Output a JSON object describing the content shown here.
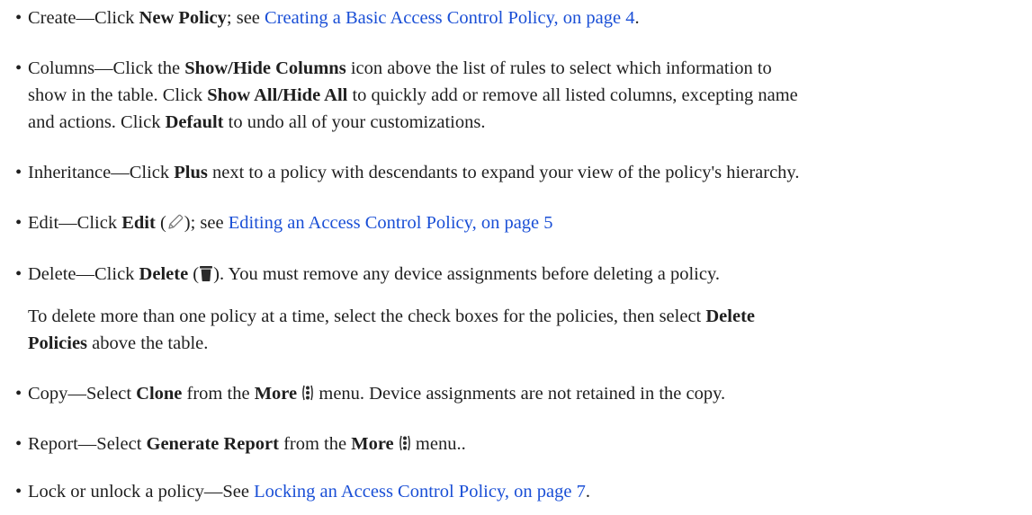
{
  "items": {
    "create": {
      "bullet": "•",
      "term": "Create",
      "dash": "—",
      "t1": "Click ",
      "b1": "New Policy",
      "t2": "; see ",
      "link": "Creating a Basic Access Control Policy, on page 4",
      "t3": "."
    },
    "columns": {
      "bullet": "•",
      "term": "Columns",
      "dash": "—",
      "t1": "Click the ",
      "b1": "Show/Hide Columns",
      "t2": " icon above the list of rules to select which information to",
      "t3": "show in the table. Click ",
      "b2": "Show All/Hide All",
      "t4": " to quickly add or remove all listed columns, excepting name",
      "t5": "and actions. Click ",
      "b3": "Default",
      "t6": " to undo all of your customizations."
    },
    "inheritance": {
      "bullet": "•",
      "term": "Inheritance",
      "dash": "—",
      "t1": "Click ",
      "b1": "Plus",
      "t2": " next to a policy with descendants to expand your view of the policy's hierarchy."
    },
    "edit": {
      "bullet": "•",
      "term": "Edit",
      "dash": "—",
      "t1": "Click ",
      "b1": "Edit",
      "t2": " (",
      "icon": "pencil-icon",
      "t3": "); see ",
      "link": "Editing an Access Control Policy, on page 5"
    },
    "delete": {
      "bullet": "•",
      "term": "Delete",
      "dash": "—",
      "t1": "Click ",
      "b1": "Delete",
      "t2": " (",
      "icon": "trash-icon",
      "t3": "). You must remove any device assignments before deleting a policy.",
      "note1": "To delete more than one policy at a time, select the check boxes for the policies, then select ",
      "note_b1": "Delete",
      "note_b2": "Policies",
      "note2": " above the table."
    },
    "copy": {
      "bullet": "•",
      "term": "Copy",
      "dash": "—",
      "t1": "Select ",
      "b1": "Clone",
      "t2": " from the ",
      "b2": "More",
      "icon": "more-vertical-icon",
      "t3": " menu. Device assignments are not retained in the copy."
    },
    "report": {
      "bullet": "•",
      "term": "Report",
      "dash": "—",
      "t1": "Select ",
      "b1": "Generate Report",
      "t2": " from the ",
      "b2": "More",
      "icon": "more-vertical-icon",
      "t3": " menu.."
    },
    "lock": {
      "bullet": "•",
      "term": "Lock or unlock a policy",
      "dash": "—",
      "t1": "See ",
      "link": "Locking an Access Control Policy, on page 7",
      "t2": "."
    }
  },
  "colors": {
    "text": "#1f1f1f",
    "link": "#1a4fd6",
    "icon": "#7a7a7a"
  }
}
